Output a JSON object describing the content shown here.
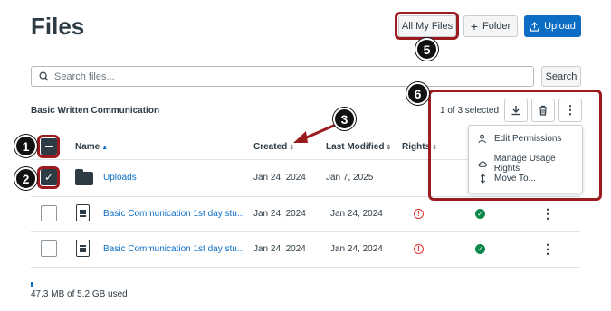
{
  "page": {
    "title": "Files"
  },
  "toolbar": {
    "all_my_files_label": "All My Files",
    "folder_label": "Folder",
    "upload_label": "Upload"
  },
  "search": {
    "placeholder": "Search files...",
    "button_label": "Search"
  },
  "section": {
    "course_name": "Basic Written Communication"
  },
  "selection": {
    "count_text": "1 of 3 selected"
  },
  "columns": {
    "name": "Name",
    "created": "Created",
    "last_modified": "Last Modified",
    "rights": "Rights"
  },
  "rows": [
    {
      "name": "Uploads",
      "created": "Jan 24, 2024",
      "last_modified": "Jan 7, 2025",
      "type": "folder",
      "checked": true
    },
    {
      "name": "Basic Communication 1st day stu...",
      "created": "Jan 24, 2024",
      "last_modified": "Jan 24, 2024",
      "type": "document",
      "checked": false
    },
    {
      "name": "Basic Communication 1st day stu...",
      "created": "Jan 24, 2024",
      "last_modified": "Jan 24, 2024",
      "type": "document",
      "checked": false
    }
  ],
  "menu": {
    "items": [
      {
        "label": "Edit Permissions",
        "icon": "permissions-icon"
      },
      {
        "label": "Manage Usage Rights",
        "icon": "cloud-icon"
      },
      {
        "label": "Move To...",
        "icon": "move-icon"
      }
    ]
  },
  "storage": {
    "usage_text": "47.3 MB of 5.2 GB used",
    "usage_fraction": 0.009
  },
  "callouts": [
    "1",
    "2",
    "3",
    "5",
    "6"
  ],
  "colors": {
    "accent": "#0b6dc4",
    "highlight": "#9b1b1f",
    "success": "#0b874b",
    "warning": "#e0302b"
  }
}
